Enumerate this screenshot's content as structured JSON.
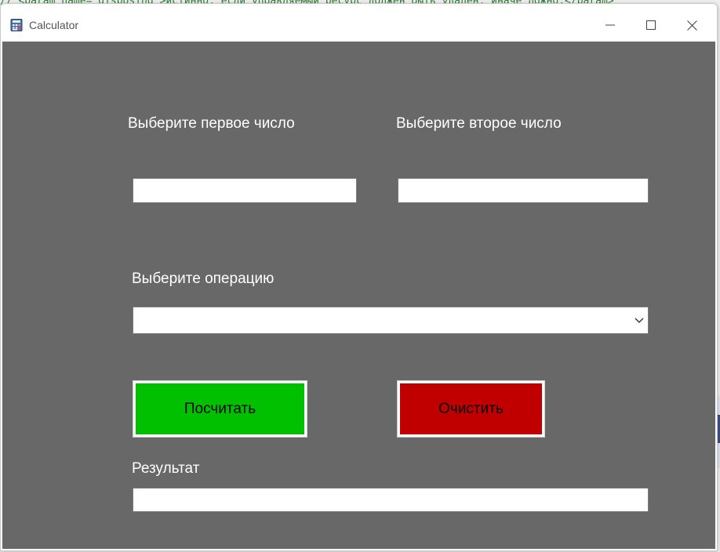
{
  "background": {
    "code_line": "// <param name=\"disposing\">истинно, если управляемый ресурс должен быть удален; иначе ложно.</param>"
  },
  "window": {
    "title": "Calculator",
    "icon": "calculator-icon",
    "controls": {
      "minimize_icon": "minimize-icon",
      "maximize_icon": "maximize-icon",
      "close_icon": "close-icon"
    }
  },
  "form": {
    "background_color": "#686868",
    "first_number_label": "Выберите первое число",
    "first_number_value": "",
    "second_number_label": "Выберите второе число",
    "second_number_value": "",
    "operation_label": "Выберите операцию",
    "operation_selected": "",
    "calculate_button": {
      "label": "Посчитать",
      "color": "#00c000"
    },
    "clear_button": {
      "label": "Очистить",
      "color": "#c00000"
    },
    "result_label": "Результат",
    "result_value": ""
  }
}
